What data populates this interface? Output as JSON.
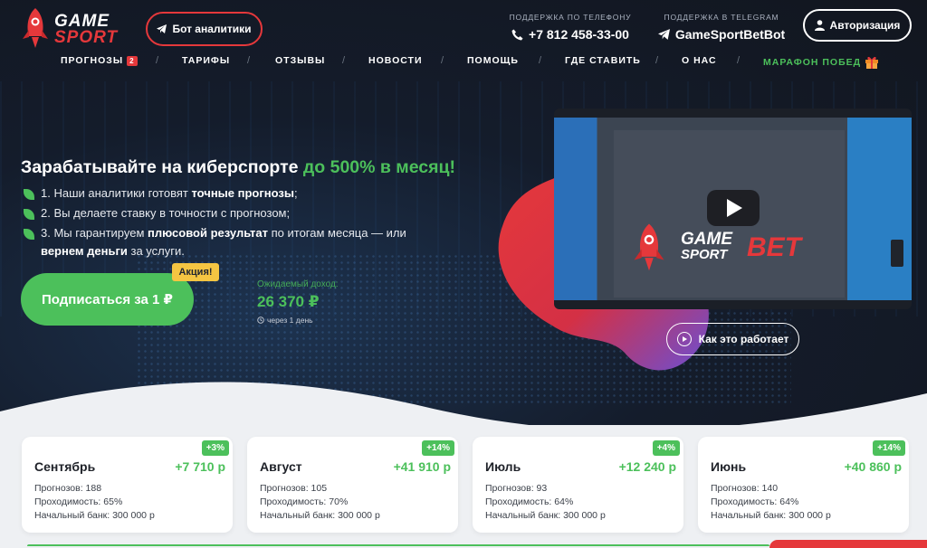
{
  "header": {
    "logo": {
      "line1": "GAME",
      "line2": "SPORT"
    },
    "bot_button": "Бот аналитики",
    "phone_label": "ПОДДЕРЖКА ПО ТЕЛЕФОНУ",
    "phone": "+7 812 458-33-00",
    "telegram_label": "ПОДДЕРЖКА В TELEGRAM",
    "telegram": "GameSportBetBot",
    "auth_button": "Авторизация"
  },
  "nav": {
    "items": [
      {
        "label": "ПРОГНОЗЫ",
        "badge": "2"
      },
      {
        "label": "ТАРИФЫ"
      },
      {
        "label": "ОТЗЫВЫ"
      },
      {
        "label": "НОВОСТИ"
      },
      {
        "label": "ПОМОЩЬ"
      },
      {
        "label": "ГДЕ СТАВИТЬ"
      },
      {
        "label": "О НАС"
      },
      {
        "label": "МАРАФОН ПОБЕД"
      }
    ],
    "separator": "/"
  },
  "hero": {
    "headline_main": "Зарабатывайте на киберспорте ",
    "headline_accent": "до 500% в месяц!",
    "bullets": [
      {
        "pre": "1. Наши аналитики готовят ",
        "bold": "точные прогнозы",
        "post": ";"
      },
      {
        "pre": "2. Вы делаете ставку в точности с прогнозом;",
        "bold": "",
        "post": ""
      },
      {
        "pre": "3. Мы гарантируем ",
        "bold": "плюсовой результат",
        "post": " по итогам месяца — или"
      }
    ],
    "bullet3_line2_bold": "вернем деньги",
    "bullet3_line2_post": " за услуги.",
    "cta": "Подписаться за 1 ₽",
    "promo": "Акция!",
    "income_label": "Ожидаемый доход:",
    "income_value": "26 370 ₽",
    "income_note": "через 1 день",
    "how_button": "Как это работает"
  },
  "video": {
    "brand_line1": "GAME",
    "brand_line2": "SPORT",
    "brand_accent": "BET"
  },
  "cards": [
    {
      "badge": "+3%",
      "month": "Сентябрь",
      "gain": "+7 710 р",
      "forecasts": "Прогнозов: 188",
      "pass": "Проходимость: 65%",
      "bank": "Начальный банк: 300 000 р"
    },
    {
      "badge": "+14%",
      "month": "Август",
      "gain": "+41 910 р",
      "forecasts": "Прогнозов: 105",
      "pass": "Проходимость: 70%",
      "bank": "Начальный банк: 300 000 р"
    },
    {
      "badge": "+4%",
      "month": "Июль",
      "gain": "+12 240 р",
      "forecasts": "Прогнозов: 93",
      "pass": "Проходимость: 64%",
      "bank": "Начальный банк: 300 000 р"
    },
    {
      "badge": "+14%",
      "month": "Июнь",
      "gain": "+40 860 р",
      "forecasts": "Прогнозов: 140",
      "pass": "Проходимость: 64%",
      "bank": "Начальный банк: 300 000 р"
    }
  ],
  "colors": {
    "accent_green": "#4cc05b",
    "accent_red": "#e5383b",
    "promo_yellow": "#f5c542",
    "hero_bg": "#141c2b"
  }
}
